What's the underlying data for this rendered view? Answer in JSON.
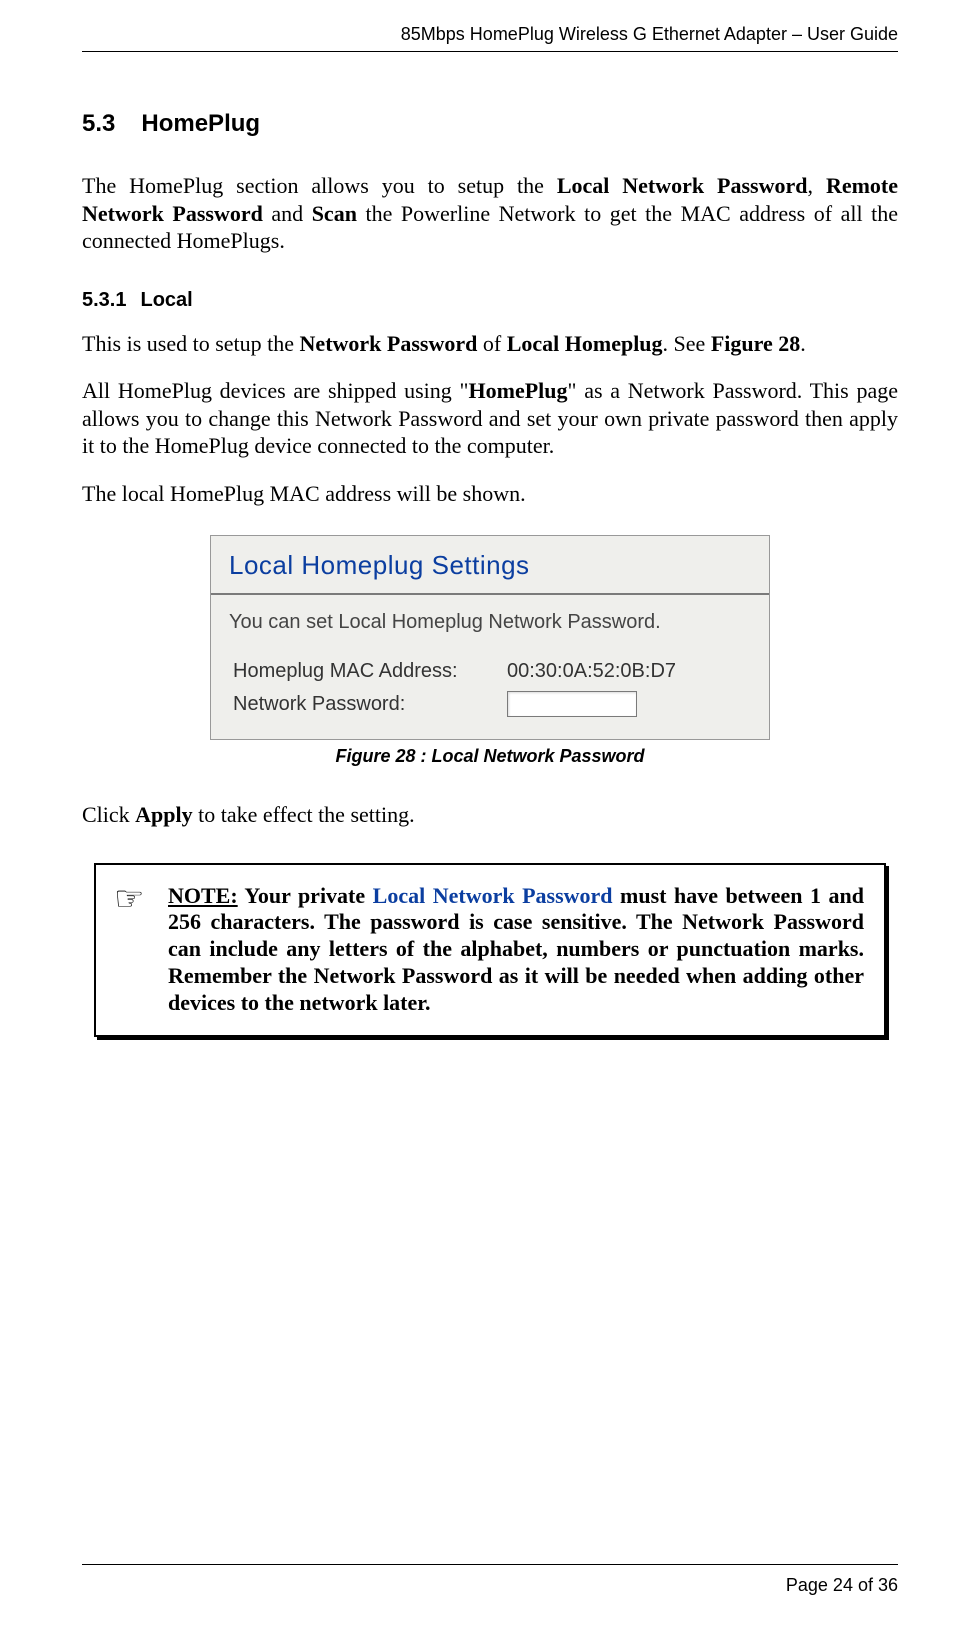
{
  "header": "85Mbps HomePlug Wireless G Ethernet Adapter – User Guide",
  "section": {
    "num": "5.3",
    "title": "HomePlug"
  },
  "intro": {
    "t1": "The HomePlug section allows you to setup the ",
    "b1": "Local Network Password",
    "t2": ", ",
    "b2": "Remote Network Password",
    "t3": " and ",
    "b3": "Scan",
    "t4": " the Powerline Network to get the MAC address of all the connected HomePlugs."
  },
  "subsection": {
    "num": "5.3.1",
    "title": "Local"
  },
  "p1": {
    "t1": "This is used to setup the ",
    "b1": "Network Password",
    "t2": " of ",
    "b2": "Local Homeplug",
    "t3": ". See ",
    "b3": "Figure 28",
    "t4": "."
  },
  "p2": {
    "t1": "All HomePlug devices are shipped using \"",
    "b1": "HomePlug",
    "t2": "\" as a Network Password. This page allows you to change this Network Password and set your own private password then apply it to the HomePlug device connected to the computer."
  },
  "p3": "The local HomePlug MAC address will be shown.",
  "screenshot": {
    "title": "Local Homeplug Settings",
    "desc": "You can set Local Homeplug Network Password.",
    "mac_label": "Homeplug MAC Address:",
    "mac_value": "00:30:0A:52:0B:D7",
    "pwd_label": "Network Password:",
    "pwd_value": ""
  },
  "caption": "Figure 28 : Local Network Password",
  "p4": {
    "t1": "Click ",
    "b1": "Apply",
    "t2": " to take effect the setting."
  },
  "note": {
    "icon": "☞",
    "label": "NOTE:",
    "t1": " Your private ",
    "blue": "Local Network Password",
    "t2": " must have between 1 and 256 characters. The password is case sensitive. The Network Password can include any letters of the alphabet, numbers or punctuation marks. Remember the Network Password as it will be needed when adding other devices to the network later."
  },
  "footer": "Page 24 of 36"
}
